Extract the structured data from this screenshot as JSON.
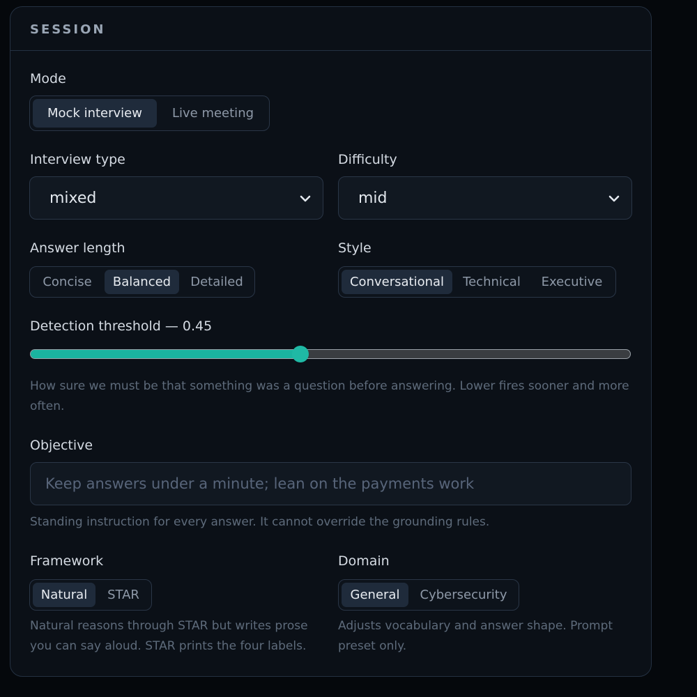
{
  "panel": {
    "title": "SESSION"
  },
  "mode": {
    "label": "Mode",
    "options": [
      "Mock interview",
      "Live meeting"
    ],
    "selected": "Mock interview"
  },
  "interview_type": {
    "label": "Interview type",
    "value": "mixed"
  },
  "difficulty": {
    "label": "Difficulty",
    "value": "mid"
  },
  "answer_length": {
    "label": "Answer length",
    "options": [
      "Concise",
      "Balanced",
      "Detailed"
    ],
    "selected": "Balanced"
  },
  "style": {
    "label": "Style",
    "options": [
      "Conversational",
      "Technical",
      "Executive"
    ],
    "selected": "Conversational"
  },
  "detection": {
    "label": "Detection threshold — 0.45",
    "value": 0.45,
    "help": "How sure we must be that something was a question before answering. Lower fires sooner and more often."
  },
  "objective": {
    "label": "Objective",
    "placeholder": "Keep answers under a minute; lean on the payments work",
    "help": "Standing instruction for every answer. It cannot override the grounding rules."
  },
  "framework": {
    "label": "Framework",
    "options": [
      "Natural",
      "STAR"
    ],
    "selected": "Natural",
    "help": "Natural reasons through STAR but writes prose you can say aloud. STAR prints the four labels."
  },
  "domain": {
    "label": "Domain",
    "options": [
      "General",
      "Cybersecurity"
    ],
    "selected": "General",
    "help": "Adjusts vocabulary and answer shape. Prompt preset only."
  },
  "colors": {
    "accent": "#1ab4a0",
    "panel_bg": "#0b1017",
    "page_bg": "#05080c"
  },
  "icons": {
    "select_arrow": "chevron-down-icon"
  }
}
